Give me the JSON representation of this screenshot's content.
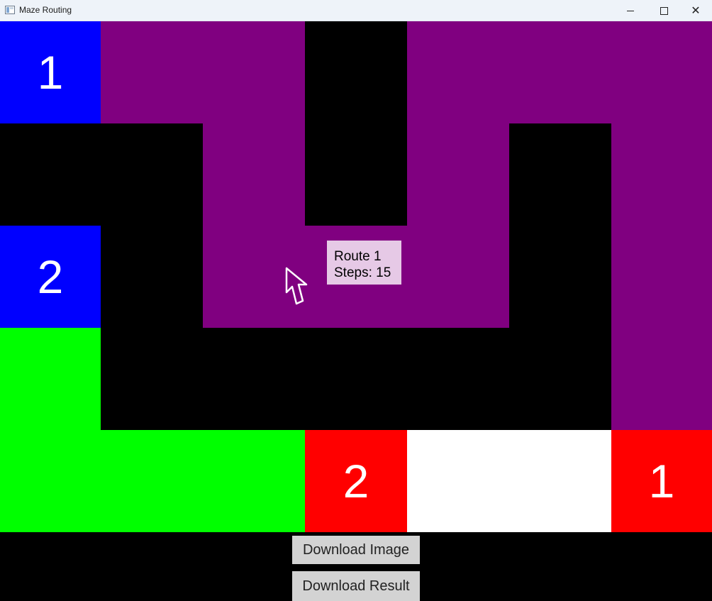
{
  "window": {
    "title": "Maze Routing",
    "controls": {
      "minimize": "minimize-icon",
      "maximize": "maximize-icon",
      "close": "close-icon"
    }
  },
  "colors": {
    "wall": "#000000",
    "route1": "#800080",
    "route2": "#00ff00",
    "source": "#0000ff",
    "target": "#ff0000",
    "empty": "#ffffff",
    "tooltip_bg": "#e6c9e6",
    "button_bg": "#d3d3d3"
  },
  "maze": {
    "columns": 7,
    "rows": 5,
    "cells": [
      [
        "source",
        "route1",
        "route1",
        "wall",
        "route1",
        "route1",
        "route1"
      ],
      [
        "wall",
        "wall",
        "route1",
        "wall",
        "route1",
        "wall",
        "route1"
      ],
      [
        "source",
        "wall",
        "route1",
        "route1",
        "route1",
        "wall",
        "route1"
      ],
      [
        "route2",
        "wall",
        "wall",
        "wall",
        "wall",
        "wall",
        "route1"
      ],
      [
        "route2",
        "route2",
        "route2",
        "target",
        "empty",
        "empty",
        "target"
      ]
    ],
    "labels": [
      {
        "row": 0,
        "col": 0,
        "text": "1"
      },
      {
        "row": 2,
        "col": 0,
        "text": "2"
      },
      {
        "row": 4,
        "col": 3,
        "text": "2"
      },
      {
        "row": 4,
        "col": 6,
        "text": "1"
      }
    ]
  },
  "tooltip": {
    "route": "Route 1",
    "steps": "Steps: 15"
  },
  "buttons": {
    "download_image": "Download Image",
    "download_result": "Download Result"
  }
}
